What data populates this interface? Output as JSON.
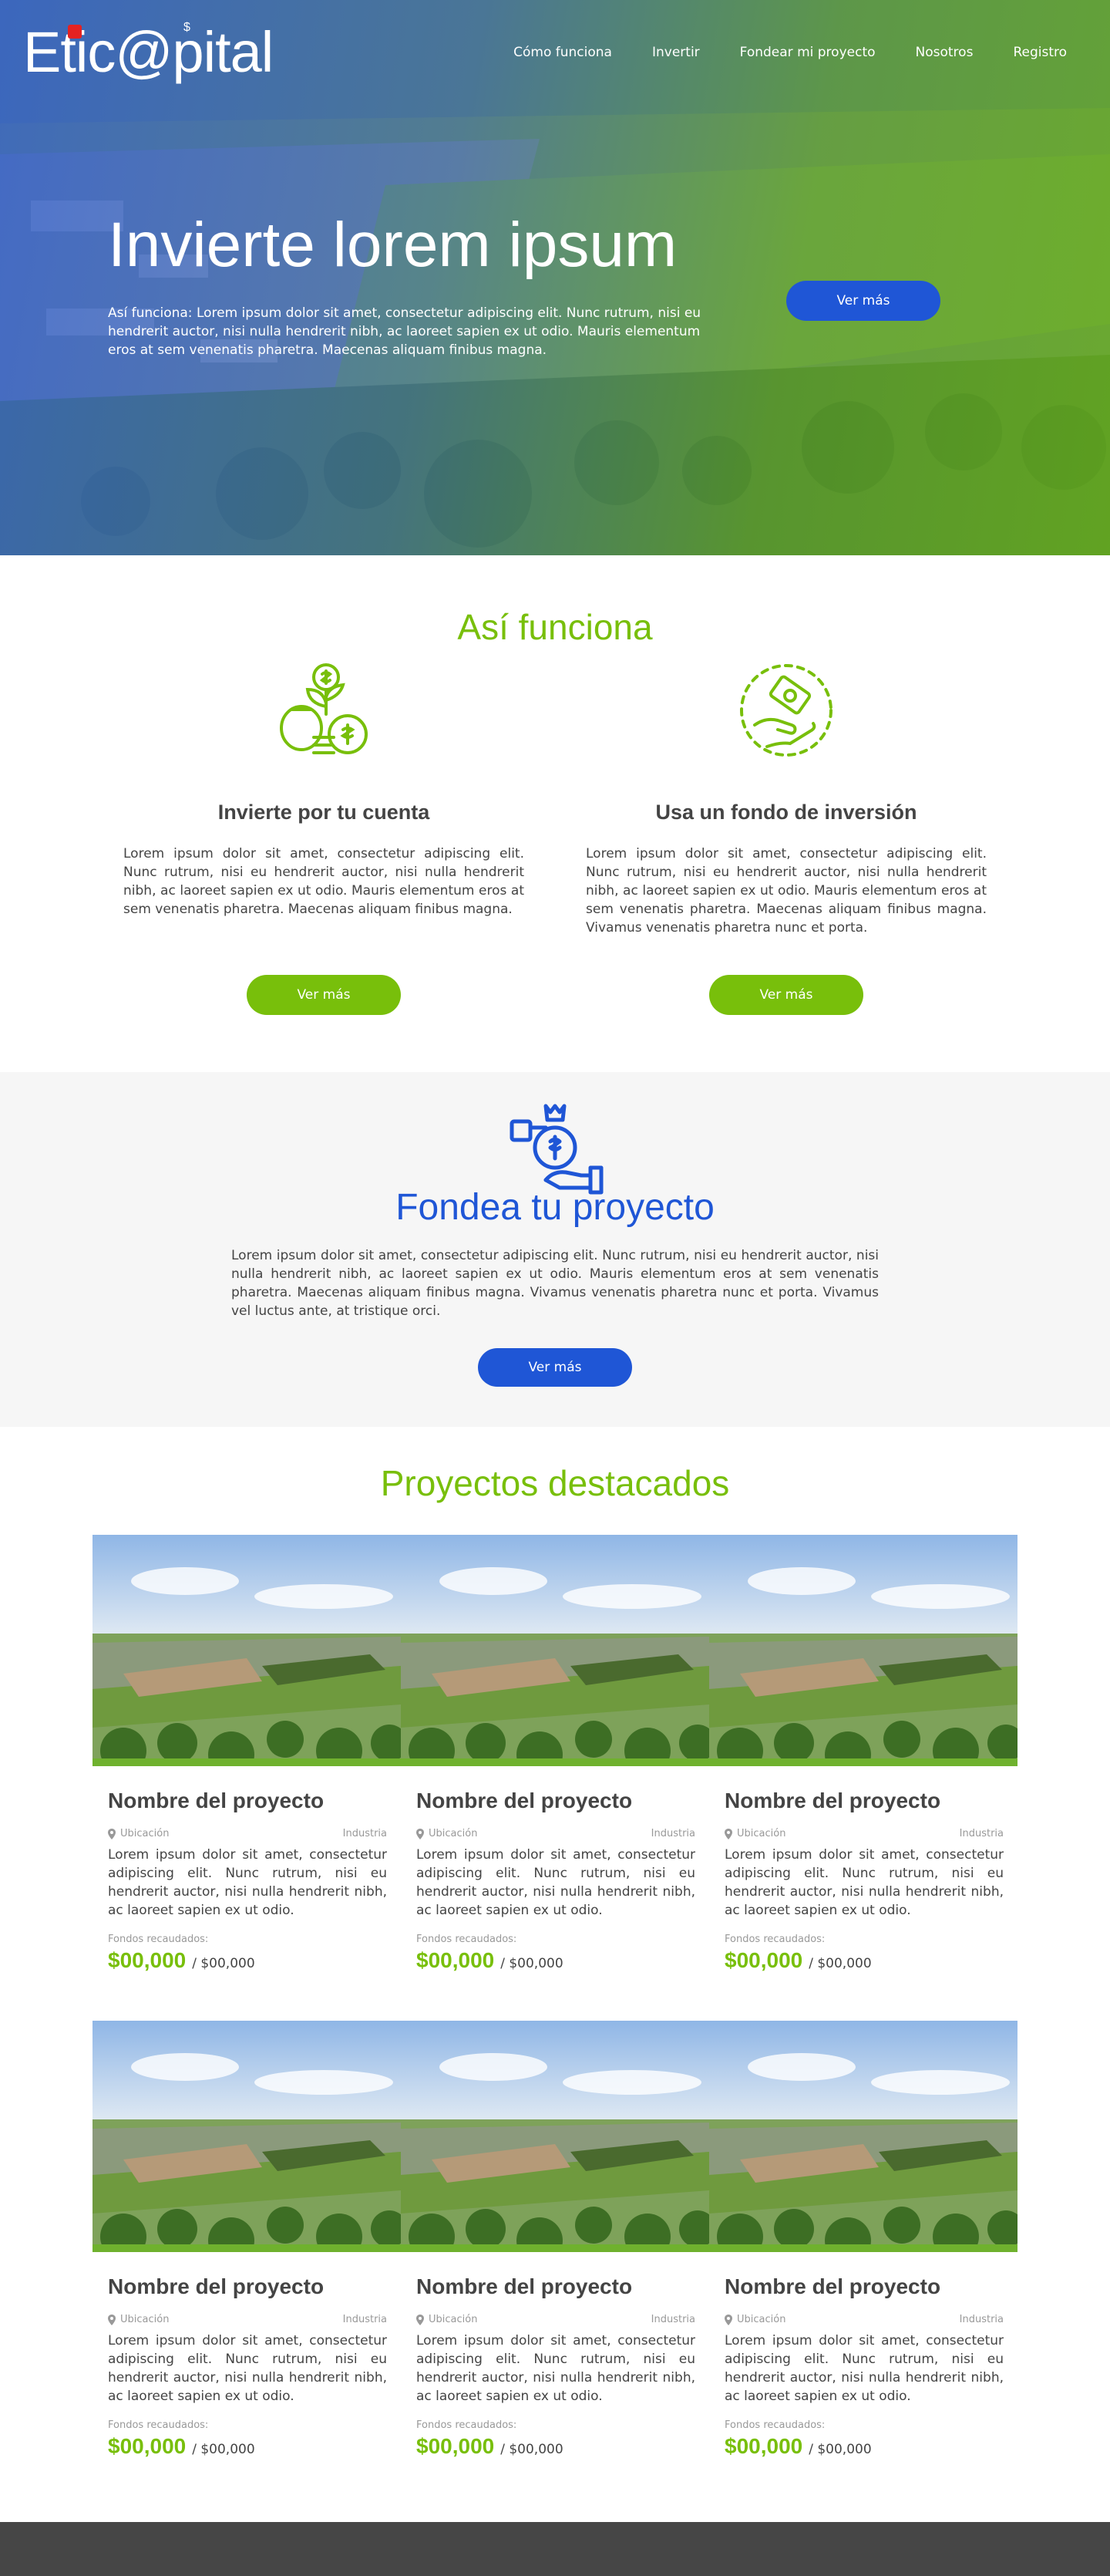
{
  "brand": {
    "logo_prefix": "Etic",
    "logo_at": "@",
    "logo_suffix": "pital",
    "logo_mark": "$",
    "accent_green": "#78bf0b",
    "accent_blue": "#1f56d6"
  },
  "nav": {
    "items": [
      "Cómo funciona",
      "Invertir",
      "Fondear mi proyecto",
      "Nosotros",
      "Registro"
    ]
  },
  "hero": {
    "title": "Invierte lorem ipsum",
    "text": "Así funciona: Lorem ipsum dolor sit amet, consectetur adipiscing elit. Nunc rutrum, nisi eu hendrerit auctor, nisi nulla hendrerit nibh, ac laoreet sapien ex ut odio. Mauris elementum eros at sem venenatis pharetra. Maecenas aliquam finibus magna.",
    "button": "Ver más"
  },
  "how_it_works": {
    "title": "Así funciona",
    "columns": [
      {
        "icon": "money-plant-icon",
        "heading": "Invierte por tu cuenta",
        "text": "Lorem ipsum dolor sit amet, consectetur adipiscing elit. Nunc rutrum, nisi eu hendrerit auctor, nisi nulla hendrerit nibh, ac laoreet sapien ex ut odio. Mauris elementum eros at sem venenatis pharetra. Maecenas aliquam finibus magna.",
        "button": "Ver más"
      },
      {
        "icon": "hand-money-icon",
        "heading": "Usa un fondo de inversión",
        "text": "Lorem ipsum dolor sit amet, consectetur adipiscing elit. Nunc rutrum, nisi eu hendrerit auctor, nisi nulla hendrerit nibh, ac laoreet sapien ex ut odio. Mauris elementum eros at sem venenatis pharetra. Maecenas aliquam finibus magna. Vivamus venenatis pharetra nunc et porta.",
        "button": "Ver más"
      }
    ]
  },
  "fund": {
    "icon": "money-bag-hand-icon",
    "title": "Fondea tu proyecto",
    "text": "Lorem ipsum dolor sit amet, consectetur adipiscing elit. Nunc rutrum, nisi eu hendrerit auctor, nisi nulla hendrerit nibh, ac laoreet sapien ex ut odio. Mauris elementum eros at sem venenatis pharetra. Maecenas aliquam finibus magna. Vivamus venenatis pharetra nunc et porta. Vivamus vel luctus ante, at tristique orci.",
    "button": "Ver más"
  },
  "projects": {
    "title": "Proyectos destacados",
    "items": [
      {
        "name": "Nombre del proyecto",
        "location": "Ubicación",
        "industry": "Industria",
        "desc": "Lorem ipsum dolor sit amet, consectetur adipiscing elit. Nunc rutrum, nisi eu hendrerit auctor, nisi nulla hendrerit nibh, ac laoreet sapien ex ut odio.",
        "funds_label": "Fondos recaudados:",
        "raised": "$00,000",
        "goal": "/ $00,000"
      },
      {
        "name": "Nombre del proyecto",
        "location": "Ubicación",
        "industry": "Industria",
        "desc": "Lorem ipsum dolor sit amet, consectetur adipiscing elit. Nunc rutrum, nisi eu hendrerit auctor, nisi nulla hendrerit nibh, ac laoreet sapien ex ut odio.",
        "funds_label": "Fondos recaudados:",
        "raised": "$00,000",
        "goal": "/ $00,000"
      },
      {
        "name": "Nombre del proyecto",
        "location": "Ubicación",
        "industry": "Industria",
        "desc": "Lorem ipsum dolor sit amet, consectetur adipiscing elit. Nunc rutrum, nisi eu hendrerit auctor, nisi nulla hendrerit nibh, ac laoreet sapien ex ut odio.",
        "funds_label": "Fondos recaudados:",
        "raised": "$00,000",
        "goal": "/ $00,000"
      },
      {
        "name": "Nombre del proyecto",
        "location": "Ubicación",
        "industry": "Industria",
        "desc": "Lorem ipsum dolor sit amet, consectetur adipiscing elit. Nunc rutrum, nisi eu hendrerit auctor, nisi nulla hendrerit nibh, ac laoreet sapien ex ut odio.",
        "funds_label": "Fondos recaudados:",
        "raised": "$00,000",
        "goal": "/ $00,000"
      },
      {
        "name": "Nombre del proyecto",
        "location": "Ubicación",
        "industry": "Industria",
        "desc": "Lorem ipsum dolor sit amet, consectetur adipiscing elit. Nunc rutrum, nisi eu hendrerit auctor, nisi nulla hendrerit nibh, ac laoreet sapien ex ut odio.",
        "funds_label": "Fondos recaudados:",
        "raised": "$00,000",
        "goal": "/ $00,000"
      },
      {
        "name": "Nombre del proyecto",
        "location": "Ubicación",
        "industry": "Industria",
        "desc": "Lorem ipsum dolor sit amet, consectetur adipiscing elit. Nunc rutrum, nisi eu hendrerit auctor, nisi nulla hendrerit nibh, ac laoreet sapien ex ut odio.",
        "funds_label": "Fondos recaudados:",
        "raised": "$00,000",
        "goal": "/ $00,000"
      }
    ]
  }
}
